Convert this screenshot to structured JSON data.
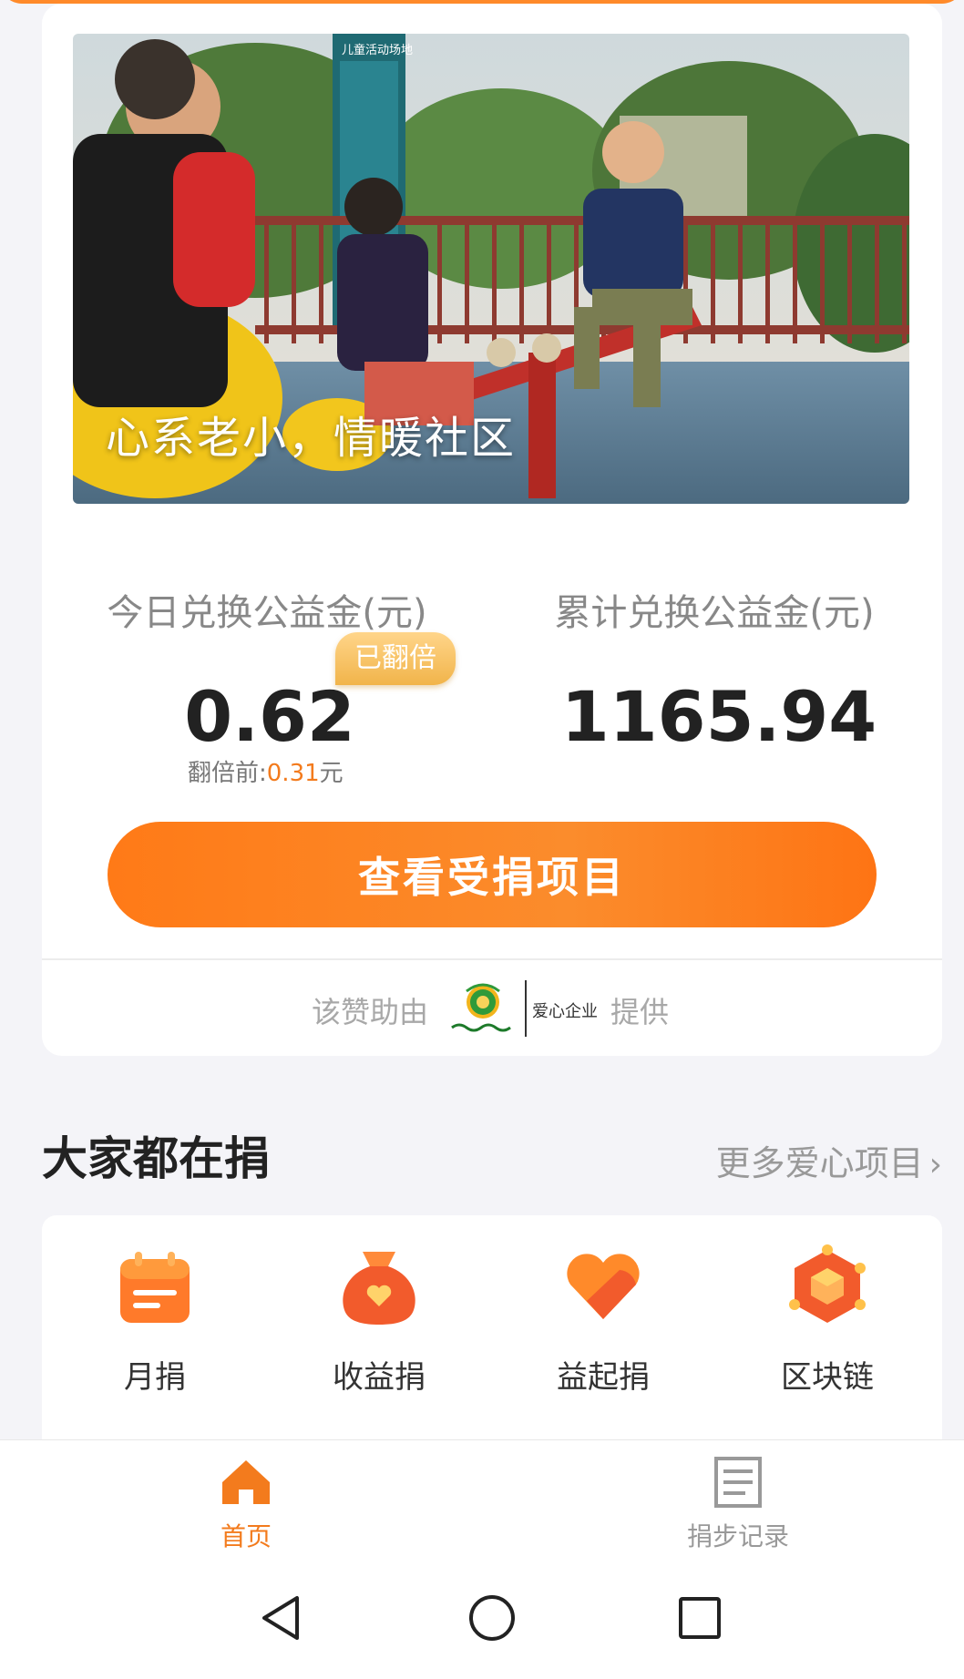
{
  "banner": {
    "caption": "心系老小，情暖社区",
    "sign_title": "儿童活动场地"
  },
  "stats": {
    "today_label": "今日兑换公益金(元)",
    "today_value": "0.62",
    "doubled_badge": "已翻倍",
    "before_prefix": "翻倍前:",
    "before_value": "0.31",
    "before_unit": "元",
    "total_label": "累计兑换公益金(元)",
    "total_value": "1165.94"
  },
  "cta_label": "查看受捐项目",
  "sponsor": {
    "prefix": "该赞助由",
    "enterprise": "爱心企业",
    "suffix": "提供"
  },
  "section": {
    "title": "大家都在捐",
    "more_label": "更多爱心项目"
  },
  "donate_types": [
    {
      "label": "月捐",
      "icon": "calendar-icon"
    },
    {
      "label": "收益捐",
      "icon": "money-bag-icon"
    },
    {
      "label": "益起捐",
      "icon": "heart-icon"
    },
    {
      "label": "区块链",
      "icon": "blockchain-icon"
    }
  ],
  "tabs": [
    {
      "label": "首页",
      "icon": "home-icon",
      "active": true
    },
    {
      "label": "捐步记录",
      "icon": "record-icon",
      "active": false
    }
  ],
  "colors": {
    "accent": "#f37b1d",
    "badge": "#f1b44a",
    "background": "#f4f4f8"
  }
}
